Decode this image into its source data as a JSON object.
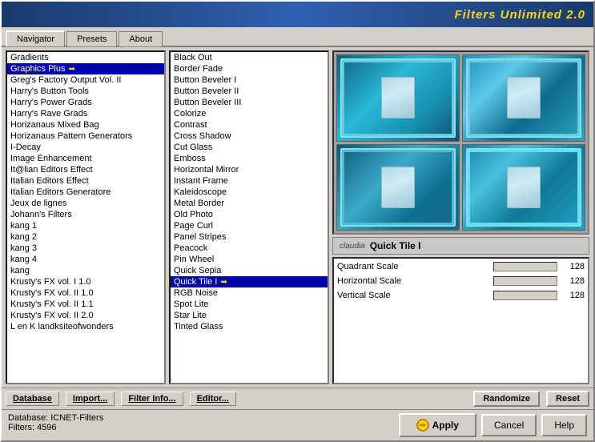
{
  "titleBar": {
    "text": "Filters Unlimited 2.0"
  },
  "tabs": [
    {
      "label": "Navigator",
      "active": true
    },
    {
      "label": "Presets",
      "active": false
    },
    {
      "label": "About",
      "active": false
    }
  ],
  "leftList": {
    "items": [
      "Gradients",
      "Graphics Plus",
      "Greg's Factory Output Vol. II",
      "Harry's Button Tools",
      "Harry's Power Grads",
      "Harry's Rave Grads",
      "Horizanaus Mixed Bag",
      "Horizanaus Pattern Generators",
      "I-Decay",
      "Image Enhancement",
      "It@lian Editors Effect",
      "Italian Editors Effect",
      "Italian Editors Generatore",
      "Jeux de lignes",
      "Johann's Filters",
      "kang 1",
      "kang 2",
      "kang 3",
      "kang 4",
      "kang",
      "Krusty's FX vol. I 1.0",
      "Krusty's FX vol. II 1.0",
      "Krusty's FX vol. II 1.1",
      "Krusty's FX vol. II 2.0",
      "L en K landksiteofwonders"
    ],
    "selectedIndex": 1
  },
  "centerList": {
    "items": [
      "Black Out",
      "Border Fade",
      "Button Beveler I",
      "Button Beveler II",
      "Button Beveler III",
      "Colorize",
      "Contrast",
      "Cross Shadow",
      "Cut Glass",
      "Emboss",
      "Horizontal Mirror",
      "Instant Frame",
      "Kaleidoscope",
      "Metal Border",
      "Old Photo",
      "Page Curl",
      "Panel Stripes",
      "Peacock",
      "Pin Wheel",
      "Quick Sepia",
      "Quick Tile I",
      "RGB Noise",
      "Spot Lite",
      "Star Lite",
      "Tinted Glass"
    ],
    "selectedIndex": 20
  },
  "filterNameBar": {
    "logo": "claudia",
    "name": "Quick Tile I"
  },
  "params": [
    {
      "label": "Quadrant Scale",
      "value": 128
    },
    {
      "label": "Horizontal Scale",
      "value": 128
    },
    {
      "label": "Vertical Scale",
      "value": 128
    }
  ],
  "bottomButtons": [
    {
      "label": "Database"
    },
    {
      "label": "Import..."
    },
    {
      "label": "Filter Info..."
    },
    {
      "label": "Editor..."
    }
  ],
  "rightButtons": [
    {
      "label": "Randomize"
    },
    {
      "label": "Reset"
    }
  ],
  "statusBar": {
    "database": "Database:  ICNET-Filters",
    "filters": "Filters:     4596"
  },
  "actionButtons": {
    "apply": "Apply",
    "cancel": "Cancel",
    "help": "Help"
  }
}
